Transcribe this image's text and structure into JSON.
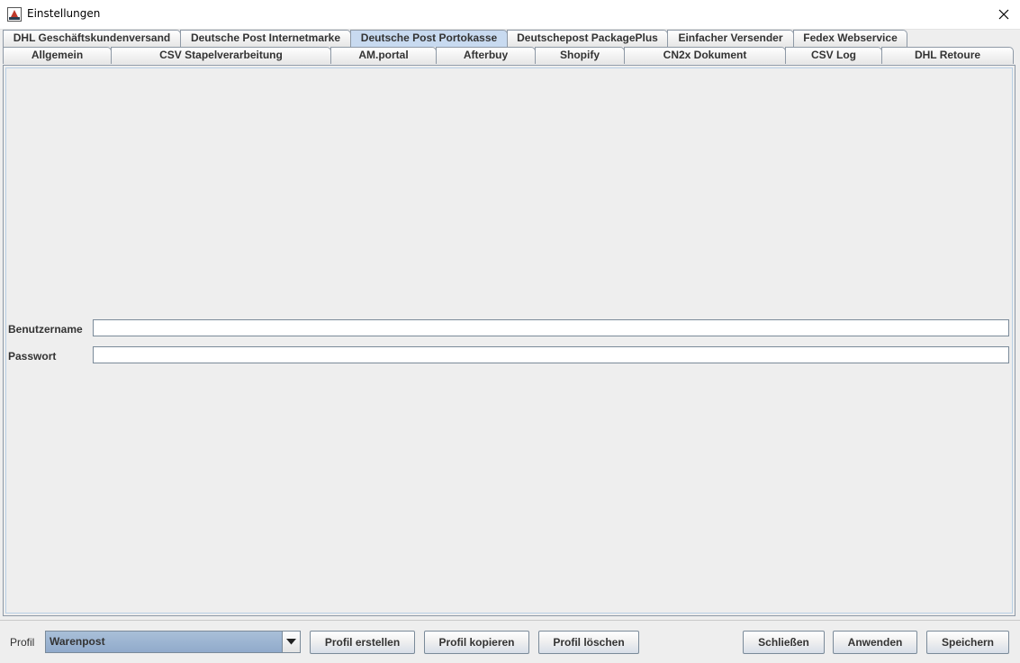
{
  "window": {
    "title": "Einstellungen"
  },
  "tabs": {
    "row1": [
      {
        "label": "DHL Geschäftskundenversand"
      },
      {
        "label": "Deutsche Post Internetmarke"
      },
      {
        "label": "Deutsche Post Portokasse",
        "selected": true
      },
      {
        "label": "Deutschepost PackagePlus"
      },
      {
        "label": "Einfacher Versender"
      },
      {
        "label": "Fedex Webservice"
      }
    ],
    "row2": [
      {
        "label": "Allgemein"
      },
      {
        "label": "CSV Stapelverarbeitung"
      },
      {
        "label": "AM.portal"
      },
      {
        "label": "Afterbuy"
      },
      {
        "label": "Shopify"
      },
      {
        "label": "CN2x Dokument"
      },
      {
        "label": "CSV Log"
      },
      {
        "label": "DHL Retoure"
      }
    ]
  },
  "form": {
    "username_label": "Benutzername",
    "username_value": "",
    "password_label": "Passwort",
    "password_value": ""
  },
  "bottom": {
    "profile_label": "Profil",
    "profile_selected": "Warenpost",
    "create_profile": "Profil erstellen",
    "copy_profile": "Profil kopieren",
    "delete_profile": "Profil löschen",
    "close": "Schließen",
    "apply": "Anwenden",
    "save": "Speichern"
  },
  "colors": {
    "selected_tab": "#c8daf0",
    "combo_background": "#9fb6d3",
    "panel_background": "#eeeeee"
  },
  "icons": {
    "app": "app-icon",
    "close": "close-icon",
    "dropdown": "chevron-down-icon"
  }
}
